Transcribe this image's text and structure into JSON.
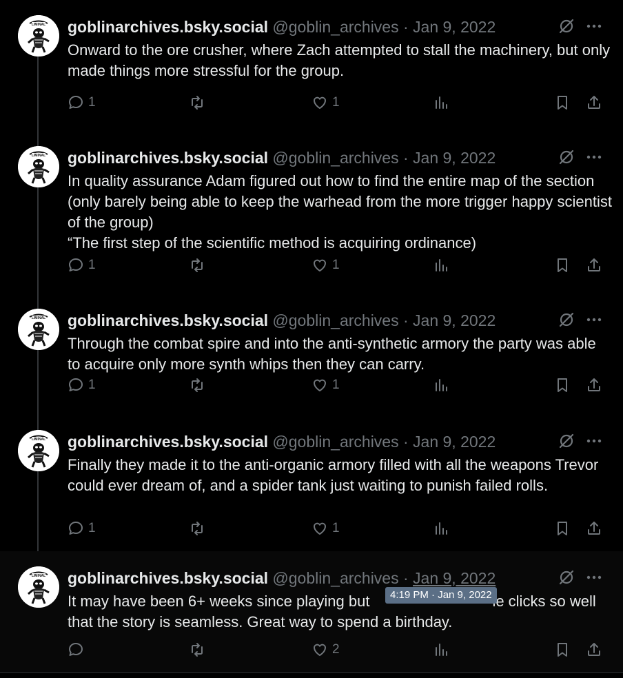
{
  "author": {
    "name": "goblinarchives.bsky.social",
    "handle": "@goblin_archives",
    "separator": "·"
  },
  "posts": [
    {
      "date": "Jan 9, 2022",
      "lines": [
        "Onward to the ore crusher, where Zach attempted to stall the machinery, but only made things more stressful for the group."
      ],
      "replies": "1",
      "retweets": "",
      "likes": "1"
    },
    {
      "date": "Jan 9, 2022",
      "lines": [
        "In quality assurance Adam figured out how to find the entire map of the section (only barely being able to keep the warhead from the more trigger happy scientist of the group)",
        "“The first step of the scientific method is acquiring ordinance)"
      ],
      "replies": "1",
      "retweets": "",
      "likes": "1"
    },
    {
      "date": "Jan 9, 2022",
      "lines": [
        "Through the combat spire and into the anti-synthetic armory the party was able to acquire only more synth whips then they can carry."
      ],
      "replies": "1",
      "retweets": "",
      "likes": "1"
    },
    {
      "date": "Jan 9, 2022",
      "lines": [
        "Finally they made it to the anti-organic armory filled with all the weapons Trevor could ever dream of, and a spider tank just waiting to punish failed rolls."
      ],
      "replies": "1",
      "retweets": "",
      "likes": "1"
    },
    {
      "date": "Jan 9, 2022",
      "lines": [
        "It may have been 6+ weeks since playing but",
        "le clicks so well that the story is seamless. Great way to spend a birthday."
      ],
      "replies": "",
      "retweets": "",
      "likes": "2"
    }
  ],
  "tooltip": "4:19 PM · Jan 9, 2022",
  "icons": {
    "avatar": "goblin-logo-avatar",
    "grok": "grok-slash-icon",
    "more": "more-horizontal-icon",
    "reply": "reply-bubble-icon",
    "retweet": "retweet-icon",
    "like": "heart-icon",
    "views": "views-bar-chart-icon",
    "bookmark": "bookmark-icon",
    "share": "share-upload-icon"
  },
  "colors": {
    "background": "#000000",
    "text": "#e7e9ea",
    "muted": "#71767b",
    "tooltip": "#5b6f86"
  }
}
